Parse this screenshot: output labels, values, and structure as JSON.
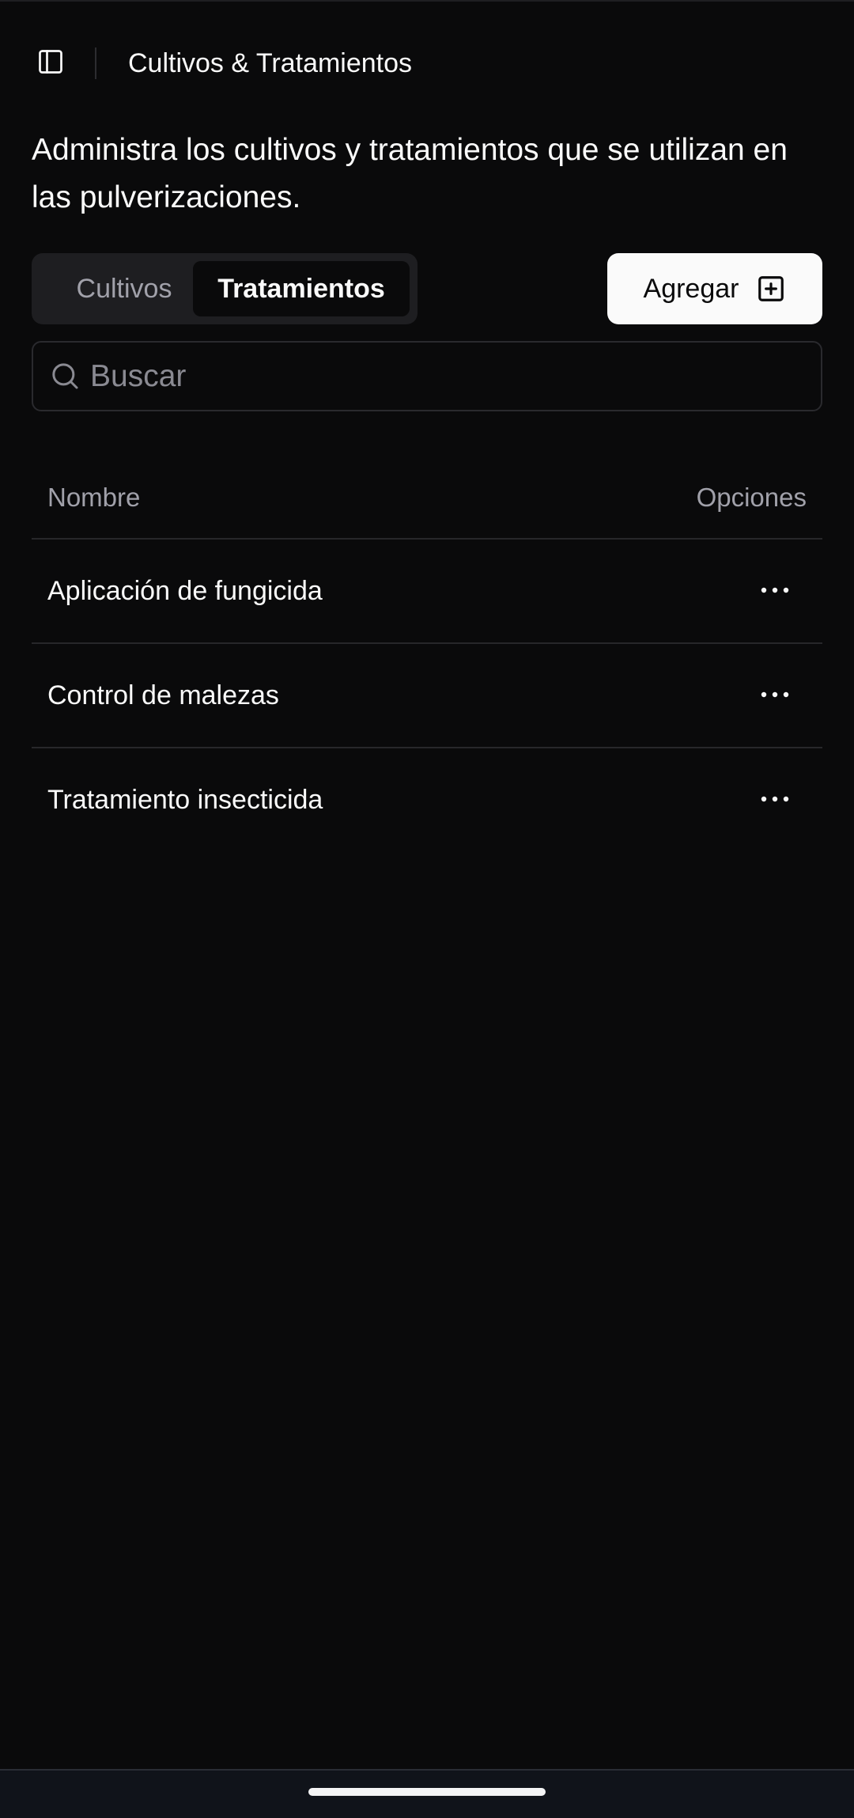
{
  "header": {
    "title": "Cultivos & Tratamientos",
    "sidebar_icon": "panel-left-icon"
  },
  "description": "Administra los cultivos y tratamientos que se utilizan en las pulverizaciones.",
  "tabs": [
    {
      "label": "Cultivos",
      "active": false
    },
    {
      "label": "Tratamientos",
      "active": true
    }
  ],
  "add_button": {
    "label": "Agregar",
    "icon": "plus-square-icon"
  },
  "search": {
    "placeholder": "Buscar",
    "value": "",
    "icon": "search-icon"
  },
  "table": {
    "columns": {
      "name": "Nombre",
      "options": "Opciones"
    },
    "rows": [
      {
        "name": "Aplicación de fungicida",
        "menu_icon": "more-horizontal-icon"
      },
      {
        "name": "Control de malezas",
        "menu_icon": "more-horizontal-icon"
      },
      {
        "name": "Tratamiento insecticida",
        "menu_icon": "more-horizontal-icon"
      }
    ]
  },
  "colors": {
    "background": "#0a0a0b",
    "foreground": "#fafafa",
    "muted": "#a1a1aa",
    "border": "#27272a",
    "nav_bar": "#10131a"
  }
}
